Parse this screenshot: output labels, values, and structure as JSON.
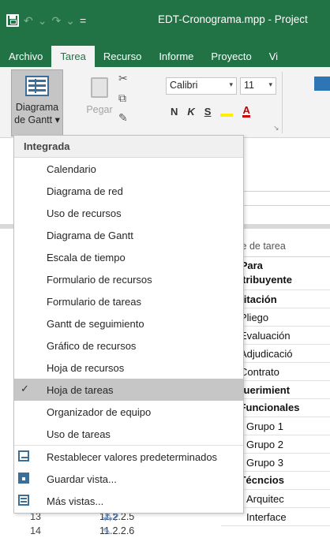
{
  "window": {
    "title": "EDT-Cronograma.mpp - Project",
    "qat": {
      "save_icon": "save-icon",
      "undo_glyph": "↶",
      "redo_glyph": "↷",
      "dropdown_glyph": "⌄",
      "customize_glyph": "="
    }
  },
  "tabs": [
    {
      "label": "Archivo",
      "active": false
    },
    {
      "label": "Tarea",
      "active": true
    },
    {
      "label": "Recurso",
      "active": false
    },
    {
      "label": "Informe",
      "active": false
    },
    {
      "label": "Proyecto",
      "active": false
    },
    {
      "label": "Vi",
      "active": false
    }
  ],
  "ribbon": {
    "gantt_button": {
      "line1": "Diagrama",
      "line2": "de Gantt ▾"
    },
    "paste_label": "Pegar",
    "font_name": "Calibri",
    "font_size": "11",
    "bold": "N",
    "italic": "K",
    "underline": "S",
    "highlight_glyph": "✐",
    "font_color_glyph": "A",
    "dropdown_glyph": "▾",
    "launcher_glyph": "↘"
  },
  "menu": {
    "header": "Integrada",
    "items": [
      {
        "label": "Calendario",
        "checked": false
      },
      {
        "label": "Diagrama de red",
        "checked": false
      },
      {
        "label": "Uso de recursos",
        "checked": false
      },
      {
        "label": "Diagrama de Gantt",
        "checked": false
      },
      {
        "label": "Escala de tiempo",
        "checked": false
      },
      {
        "label": "Formulario de recursos",
        "checked": false
      },
      {
        "label": "Formulario de tareas",
        "checked": false
      },
      {
        "label": "Gantt de seguimiento",
        "checked": false
      },
      {
        "label": "Gráfico de recursos",
        "checked": false
      },
      {
        "label": "Hoja de recursos",
        "checked": false
      },
      {
        "label": "Hoja de tareas",
        "checked": true
      },
      {
        "label": "Organizador de equipo",
        "checked": false
      },
      {
        "label": "Uso de tareas",
        "checked": false
      }
    ],
    "actions": [
      {
        "label": "Restablecer valores predeterminados",
        "icon": "reset-view-icon"
      },
      {
        "label": "Guardar vista...",
        "icon": "save-view-icon"
      },
      {
        "label": "Más vistas...",
        "icon": "more-views-icon"
      }
    ],
    "check_glyph": "✓"
  },
  "grid": {
    "header": "mbre de tarea",
    "rows": [
      {
        "name": "PP Para contribuyente",
        "level": 0,
        "summary": true
      },
      {
        "name": "Licitación",
        "level": 1,
        "summary": true
      },
      {
        "name": "Pliego",
        "level": 2,
        "summary": false
      },
      {
        "name": "Evaluación",
        "level": 2,
        "summary": false
      },
      {
        "name": "Adjudicació",
        "level": 2,
        "summary": false
      },
      {
        "name": "Contrato",
        "level": 2,
        "summary": false
      },
      {
        "name": "Requerimient",
        "level": 0,
        "summary": true
      },
      {
        "name": "◢ Funcionales",
        "level": 1,
        "summary": true
      },
      {
        "name": "Grupo 1",
        "level": 3,
        "summary": false
      },
      {
        "name": "Grupo 2",
        "level": 3,
        "summary": false
      },
      {
        "name": "Grupo 3",
        "level": 3,
        "summary": false
      },
      {
        "name": "◢ Técncios",
        "level": 1,
        "summary": true
      },
      {
        "name": "Arquitec",
        "level": 3,
        "summary": false
      },
      {
        "name": "Interface",
        "level": 3,
        "summary": false
      }
    ]
  },
  "bottom_rows": [
    {
      "row": "13",
      "wbs": "11.2.2.5",
      "indicator": "⁂?"
    },
    {
      "row": "14",
      "wbs": "11.2.2.6",
      "indicator": "✎"
    }
  ]
}
